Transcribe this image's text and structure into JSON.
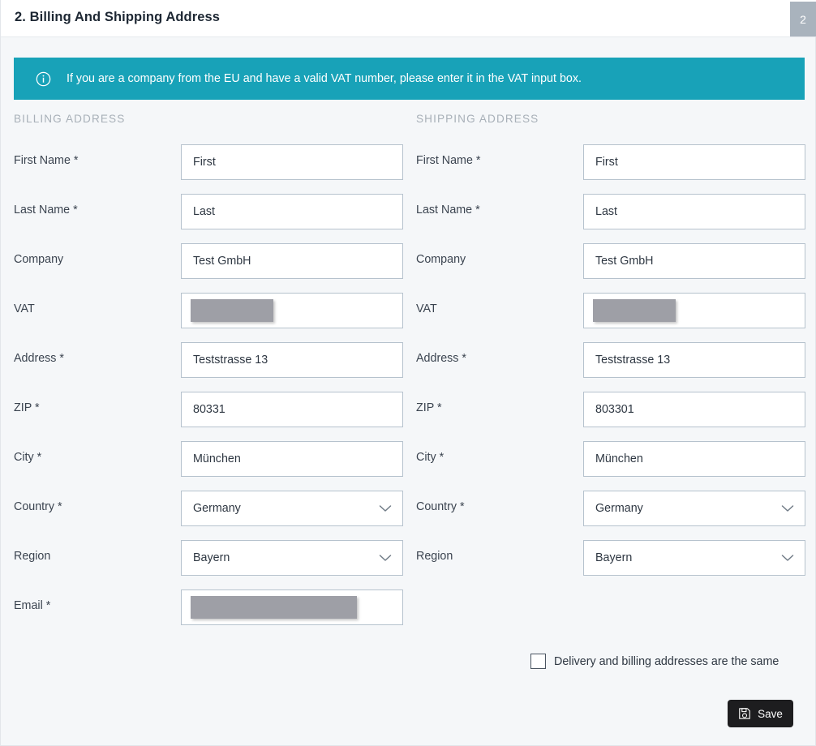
{
  "header": {
    "title": "2. Billing And Shipping Address",
    "step_number": "2"
  },
  "info_banner": {
    "icon": "info-circle-icon",
    "message": "If you are a company from the EU and have a valid VAT number, please enter it in the VAT input box.",
    "background_color": "#18a2b8"
  },
  "billing": {
    "heading": "BILLING ADDRESS",
    "fields": [
      {
        "label": "First Name *",
        "value": "First",
        "type": "text"
      },
      {
        "label": "Last Name *",
        "value": "Last",
        "type": "text"
      },
      {
        "label": "Company",
        "value": "Test GmbH",
        "type": "text"
      },
      {
        "label": "VAT",
        "value": "",
        "type": "redacted-short"
      },
      {
        "label": "Address *",
        "value": "Teststrasse 13",
        "type": "text"
      },
      {
        "label": "ZIP *",
        "value": "80331",
        "type": "text"
      },
      {
        "label": "City *",
        "value": "München",
        "type": "text"
      },
      {
        "label": "Country *",
        "value": "Germany",
        "type": "select"
      },
      {
        "label": "Region",
        "value": "Bayern",
        "type": "select"
      },
      {
        "label": "Email *",
        "value": "",
        "type": "redacted-long"
      }
    ]
  },
  "shipping": {
    "heading": "SHIPPING ADDRESS",
    "fields": [
      {
        "label": "First Name *",
        "value": "First",
        "type": "text"
      },
      {
        "label": "Last Name *",
        "value": "Last",
        "type": "text"
      },
      {
        "label": "Company",
        "value": "Test GmbH",
        "type": "text"
      },
      {
        "label": "VAT",
        "value": "",
        "type": "redacted-short"
      },
      {
        "label": "Address *",
        "value": "Teststrasse 13",
        "type": "text"
      },
      {
        "label": "ZIP *",
        "value": "803301",
        "type": "text"
      },
      {
        "label": "City *",
        "value": "München",
        "type": "text"
      },
      {
        "label": "Country *",
        "value": "Germany",
        "type": "select"
      },
      {
        "label": "Region",
        "value": "Bayern",
        "type": "select"
      }
    ]
  },
  "footer": {
    "same_address_label": "Delivery and billing addresses are the same",
    "same_address_checked": false,
    "save_label": "Save",
    "save_icon": "floppy-disk-icon",
    "save_background_color": "#1d1d1f"
  }
}
